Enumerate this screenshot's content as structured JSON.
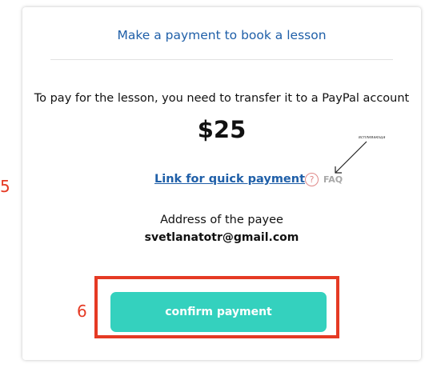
{
  "card": {
    "title": "Make a payment to book a lesson",
    "instruction": "To pay for the lesson, you need to transfer it to a PayPal account",
    "amount": "$25",
    "quick_link_label": "Link for quick payment",
    "faq": {
      "icon": "question-circle-icon",
      "icon_glyph": "?",
      "label": "FAQ"
    },
    "payee_label": "Address of the payee",
    "payee_email": "svetlanatotr@gmail.com",
    "confirm_button_label": "confirm payment"
  },
  "annotations": {
    "handwritten_note": "вспливающа",
    "step_5": "5",
    "step_6": "6"
  },
  "colors": {
    "title": "#1f5fa8",
    "link": "#1f5fa8",
    "confirm_button": "#34d1be",
    "annotation": "#e53a24",
    "faq_icon": "#e08a8a"
  }
}
